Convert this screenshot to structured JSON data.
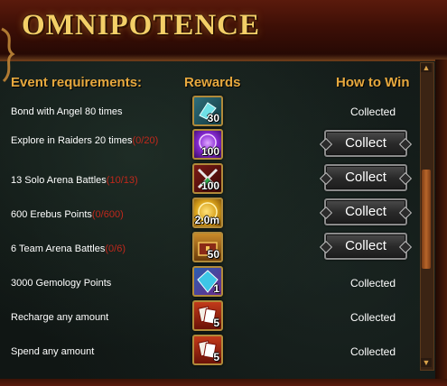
{
  "title": "OMNIPOTENCE",
  "headers": {
    "requirements": "Event requirements:",
    "rewards": "Rewards",
    "how_to_win": "How to Win"
  },
  "rows": [
    {
      "req": "Bond with Angel 80 times",
      "progress": "",
      "reward_icon": "angel-bond-item-icon",
      "reward_count": "30",
      "status": "Collected"
    },
    {
      "req": "Explore in Raiders 20 times",
      "progress": "(0/20)",
      "reward_icon": "purple-orb-icon",
      "reward_count": "100",
      "status": "Collect"
    },
    {
      "req": "13 Solo Arena Battles",
      "progress": "(10/13)",
      "reward_icon": "crossed-swords-icon",
      "reward_count": "100",
      "status": "Collect"
    },
    {
      "req": "600 Erebus Points",
      "progress": "(0/600)",
      "reward_icon": "gold-coin-icon",
      "reward_count": "2.0m",
      "status": "Collect"
    },
    {
      "req": "6 Team Arena Battles",
      "progress": "(0/6)",
      "reward_icon": "treasure-chest-icon",
      "reward_count": "50",
      "status": "Collect"
    },
    {
      "req": "3000 Gemology Points",
      "progress": "",
      "reward_icon": "gemology-icon",
      "reward_count": "1",
      "status": "Collected"
    },
    {
      "req": "Recharge any amount",
      "progress": "",
      "reward_icon": "card-pack-icon",
      "reward_count": "5",
      "status": "Collected"
    },
    {
      "req": "Spend any amount",
      "progress": "",
      "reward_icon": "card-pack-icon",
      "reward_count": "5",
      "status": "Collected"
    }
  ],
  "colors": {
    "title": "#f3cf67",
    "header": "#e8a93e",
    "progress": "#c0281c",
    "text": "#ffffff"
  }
}
